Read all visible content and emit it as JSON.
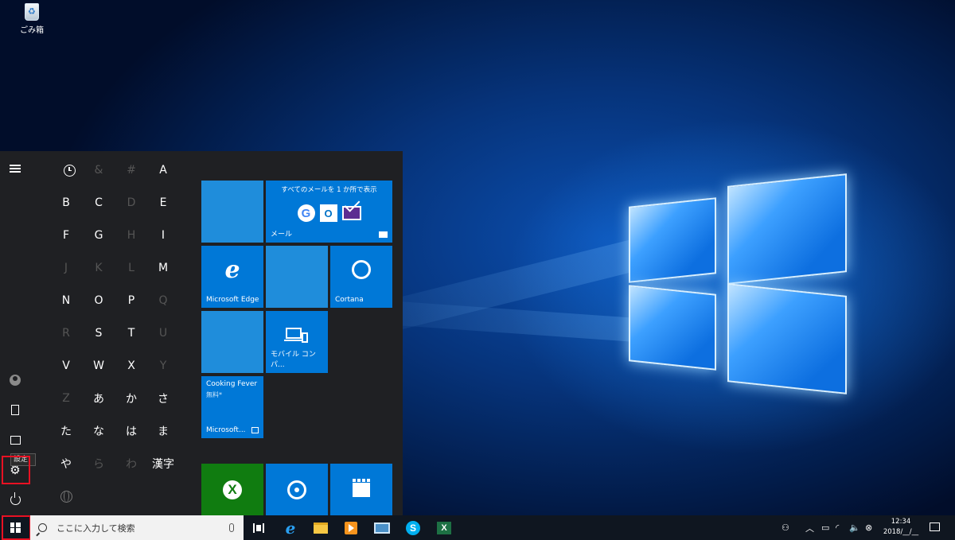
{
  "desktop": {
    "recycle_bin_label": "ごみ箱"
  },
  "start_menu": {
    "settings_tooltip": "設定",
    "letters": [
      {
        "label": "&",
        "enabled": false
      },
      {
        "label": "#",
        "enabled": false
      },
      {
        "label": "A",
        "enabled": true
      },
      {
        "label": "B",
        "enabled": true
      },
      {
        "label": "C",
        "enabled": true
      },
      {
        "label": "D",
        "enabled": false
      },
      {
        "label": "E",
        "enabled": true
      },
      {
        "label": "F",
        "enabled": true
      },
      {
        "label": "G",
        "enabled": true
      },
      {
        "label": "H",
        "enabled": false
      },
      {
        "label": "I",
        "enabled": true
      },
      {
        "label": "J",
        "enabled": false
      },
      {
        "label": "K",
        "enabled": false
      },
      {
        "label": "L",
        "enabled": false
      },
      {
        "label": "M",
        "enabled": true
      },
      {
        "label": "N",
        "enabled": true
      },
      {
        "label": "O",
        "enabled": true
      },
      {
        "label": "P",
        "enabled": true
      },
      {
        "label": "Q",
        "enabled": false
      },
      {
        "label": "R",
        "enabled": false
      },
      {
        "label": "S",
        "enabled": true
      },
      {
        "label": "T",
        "enabled": true
      },
      {
        "label": "U",
        "enabled": false
      },
      {
        "label": "V",
        "enabled": true
      },
      {
        "label": "W",
        "enabled": true
      },
      {
        "label": "X",
        "enabled": true
      },
      {
        "label": "Y",
        "enabled": false
      },
      {
        "label": "Z",
        "enabled": false
      },
      {
        "label": "あ",
        "enabled": true
      },
      {
        "label": "か",
        "enabled": true
      },
      {
        "label": "さ",
        "enabled": true
      },
      {
        "label": "た",
        "enabled": true
      },
      {
        "label": "な",
        "enabled": true
      },
      {
        "label": "は",
        "enabled": true
      },
      {
        "label": "ま",
        "enabled": true
      },
      {
        "label": "や",
        "enabled": true
      },
      {
        "label": "ら",
        "enabled": false
      },
      {
        "label": "わ",
        "enabled": false
      },
      {
        "label": "漢字",
        "enabled": true
      }
    ],
    "tiles": {
      "mail_header": "すべてのメールを 1 か所で表示",
      "mail_label": "メール",
      "edge_label": "Microsoft Edge",
      "cortana_label": "Cortana",
      "mobile_label": "モバイル コンパ...",
      "cooking_name": "Cooking Fever",
      "cooking_sub": "無料*",
      "store_label": "Microsoft..."
    }
  },
  "taskbar": {
    "search_placeholder": "ここに入力して検索",
    "clock_time": "12:34",
    "clock_date": "2018/__/__"
  },
  "colors": {
    "tile_blue": "#0078d7",
    "xbox_green": "#107c10",
    "highlight_red": "#e81123",
    "start_bg": "#1f2023"
  }
}
